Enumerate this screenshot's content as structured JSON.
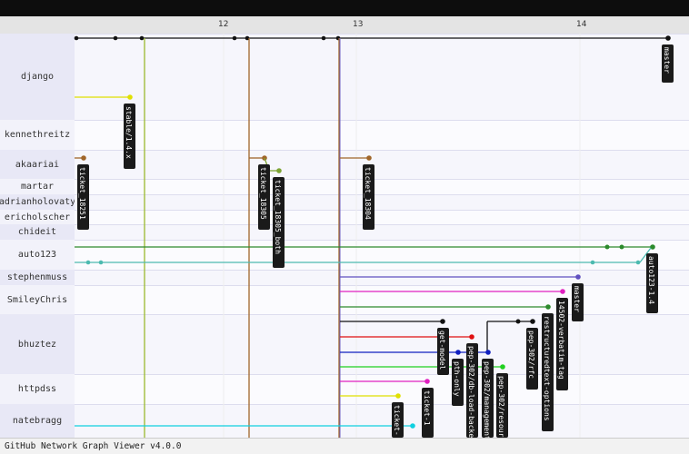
{
  "dates": [
    "12",
    "13",
    "14"
  ],
  "users": [
    "django",
    "kennethreitz",
    "akaariai",
    "martar",
    "adrianholovaty",
    "ericholscher",
    "chideit",
    "auto123",
    "stephenmuss",
    "SmileyChris",
    "bhuztez",
    "httpdss",
    "natebragg"
  ],
  "branch_labels": {
    "master_django": "master",
    "stable": "stable/1.4.x",
    "t18251": "ticket_18251",
    "t18305": "ticket_18305",
    "t18305b": "ticket_18305_both",
    "t18304": "ticket_18304",
    "auto14": "auto123-1.4",
    "master_sm": "master",
    "verbatim": "14502-verbatim-tag",
    "restruct": "restructuredtext-options",
    "rfc": "pep-302/rfc",
    "getmodel": "get-model",
    "pthonly": "pth-only",
    "dbloader": "pep-302/db-load-backends",
    "manage": "pep-302/management",
    "resource": "pep-302/resource",
    "ticket1": "ticket-1",
    "ticket2": "ticket-"
  },
  "colors": {
    "trunk": "#111111",
    "stable": "#e0e000",
    "django_green": "#9ab92e",
    "brown": "#a0662a",
    "greenbr": "#7da434",
    "purple": "#7060c0",
    "auto_green": "#2c8a2c",
    "teal": "#4cbab0",
    "violet": "#6050c0",
    "magenta": "#e020c0",
    "red": "#e01010",
    "blue": "#1020c0",
    "lime": "#20d020",
    "cyan": "#10d0e0"
  },
  "footer": "GitHub Network Graph Viewer v4.0.0"
}
